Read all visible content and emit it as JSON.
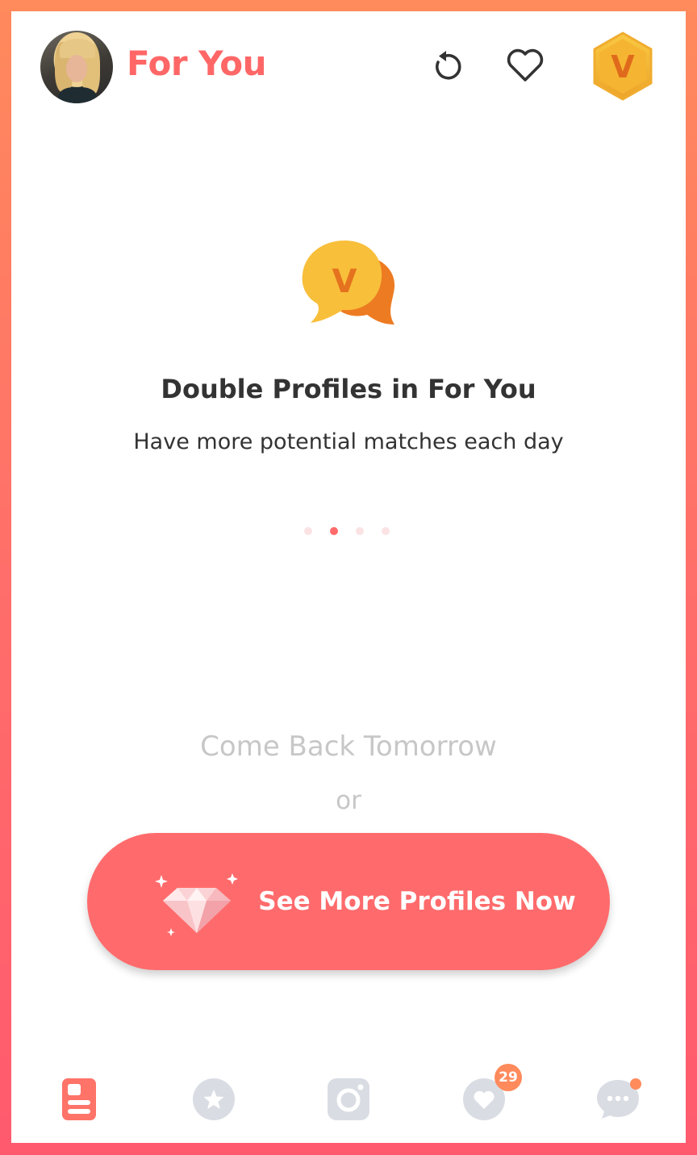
{
  "header": {
    "title": "For You",
    "vip_letter": "V"
  },
  "hero": {
    "icon_letter": "V",
    "headline": "Double Profiles in For You",
    "subline": "Have more potential matches each day",
    "carousel": {
      "pages": 4,
      "active_index": 1
    }
  },
  "cta": {
    "come_back": "Come Back Tomorrow",
    "or": "or",
    "button_label": "See More Profiles Now"
  },
  "tabbar": {
    "items": [
      {
        "name": "for-you",
        "icon": "cards-icon",
        "active": true
      },
      {
        "name": "stars",
        "icon": "star-icon",
        "active": false
      },
      {
        "name": "moments",
        "icon": "camera-icon",
        "active": false
      },
      {
        "name": "likes",
        "icon": "heart-icon",
        "active": false,
        "badge": "29"
      },
      {
        "name": "chat",
        "icon": "chat-bubble-icon",
        "active": false,
        "dot": true
      }
    ]
  },
  "colors": {
    "accent": "#ff6767",
    "button": "#ff6b6c",
    "badge": "#ff8a5c",
    "vip_gold": "#f2b33a",
    "inactive_icon": "#d9dde3"
  }
}
